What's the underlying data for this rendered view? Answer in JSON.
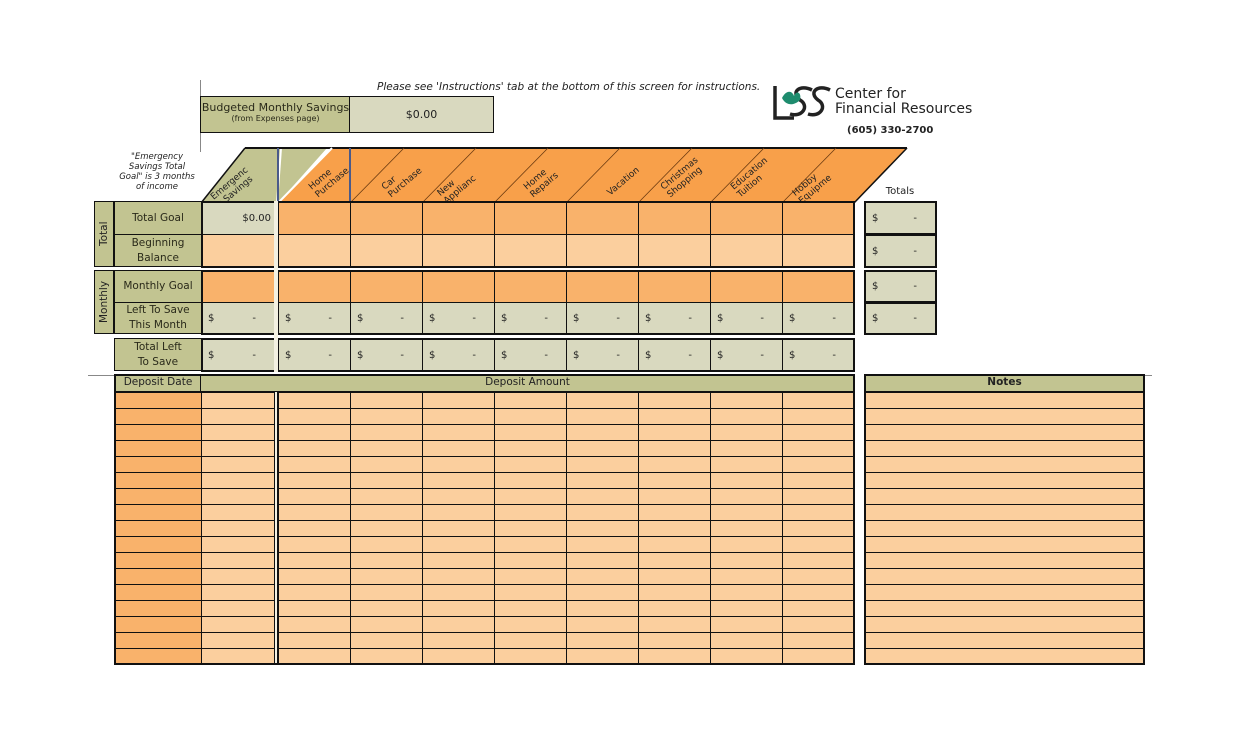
{
  "instructions_text": "Please see 'Instructions' tab at the bottom of this screen for instructions.",
  "budget": {
    "label": "Budgeted Monthly Savings",
    "sublabel": "(from Expenses page)",
    "value": "$0.00"
  },
  "logo": {
    "mark": "LSS",
    "line1": "Center for",
    "line2": "Financial Resources",
    "phone": "(605) 330-2700"
  },
  "emergency_note": "\"Emergency Savings Total Goal\" is 3 months of income",
  "categories": [
    {
      "label": "Emergenc\ny Savings"
    },
    {
      "label": "Home\nPurchase"
    },
    {
      "label": "Car\nPurchase"
    },
    {
      "label": "New\nApplianc\nes"
    },
    {
      "label": "Home\nRepairs"
    },
    {
      "label": "Vacation"
    },
    {
      "label": "Christmas\nShopping"
    },
    {
      "label": "Education\nTuition"
    },
    {
      "label": "Hobby\nEquipme\nnt"
    }
  ],
  "totals_header": "Totals",
  "groups": {
    "total": "Total",
    "monthly": "Monthly"
  },
  "rows": {
    "total_goal": "Total Goal",
    "beginning_balance": "Beginning Balance",
    "monthly_goal": "Monthly Goal",
    "left_to_save": "Left To Save This Month",
    "total_left": "Total Left To Save"
  },
  "values": {
    "total_goal_emergency": "$0.00",
    "currency": "$",
    "dash": "-"
  },
  "deposit": {
    "date_header": "Deposit Date",
    "amount_header": "Deposit Amount",
    "notes_header": "Notes",
    "row_count": 17
  }
}
